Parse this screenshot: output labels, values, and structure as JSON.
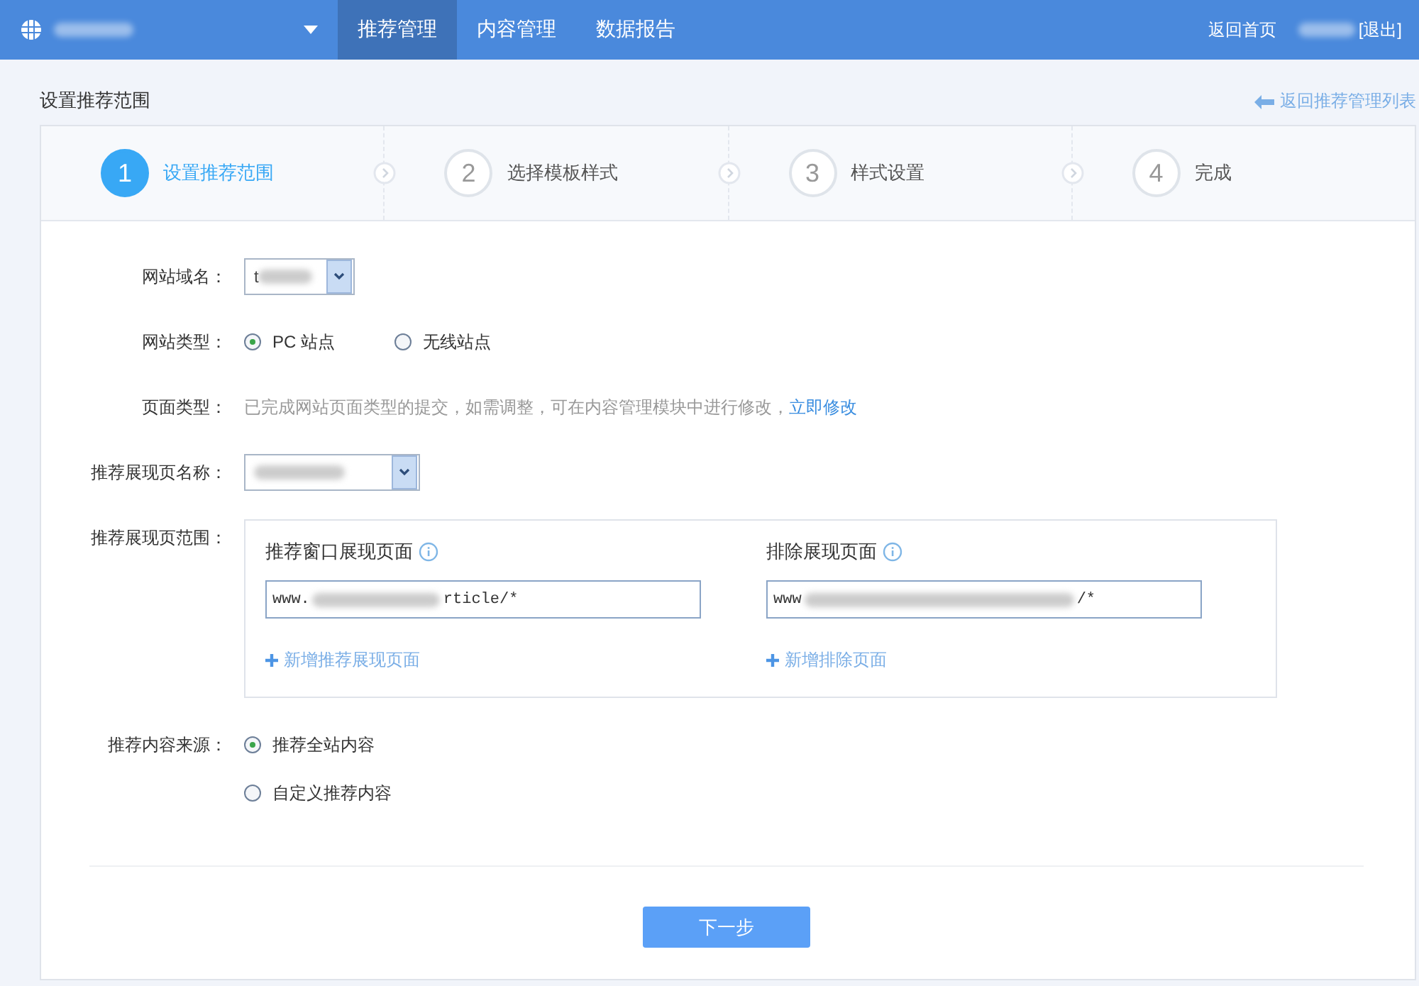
{
  "topbar": {
    "tabs": [
      {
        "label": "推荐管理",
        "selected": true
      },
      {
        "label": "内容管理",
        "selected": false
      },
      {
        "label": "数据报告",
        "selected": false
      }
    ],
    "home_link": "返回首页",
    "logout": "[退出]"
  },
  "page_title": "设置推荐范围",
  "back_link": "返回推荐管理列表",
  "steps": [
    {
      "number": "1",
      "label": "设置推荐范围",
      "selected": true
    },
    {
      "number": "2",
      "label": "选择模板样式",
      "selected": false
    },
    {
      "number": "3",
      "label": "样式设置",
      "selected": false
    },
    {
      "number": "4",
      "label": "完成",
      "selected": false
    }
  ],
  "form": [
    {
      "kind": "select",
      "label": "网站域名：",
      "value": "t"
    },
    {
      "kind": "radio",
      "label": "网站类型：",
      "options": [
        {
          "label": "PC 站点",
          "selected": true
        },
        {
          "label": "无线站点",
          "selected": false
        }
      ]
    },
    {
      "kind": "note",
      "label": "页面类型：",
      "text": "已完成网站页面类型的提交，如需调整，可在内容管理模块中进行修改，",
      "link": "立即修改"
    },
    {
      "label": "推荐展现页名称：",
      "kind": "select"
    },
    {
      "kind": "range",
      "label": "推荐展现页范围：",
      "columns": [
        {
          "title": "推荐窗口展现页面",
          "value_start": "www.",
          "value_end": "rticle/*",
          "add_link": "新增推荐展现页面"
        },
        {
          "title": "排除展现页面",
          "value_start": "www",
          "value_end": "/*",
          "add_link": "新增排除页面"
        }
      ]
    },
    {
      "kind": "radio-stack",
      "label": "推荐内容来源：",
      "options": [
        {
          "label": "推荐全站内容",
          "selected": true
        },
        {
          "label": "自定义推荐内容",
          "selected": false
        }
      ]
    }
  ],
  "next_button": "下一步"
}
